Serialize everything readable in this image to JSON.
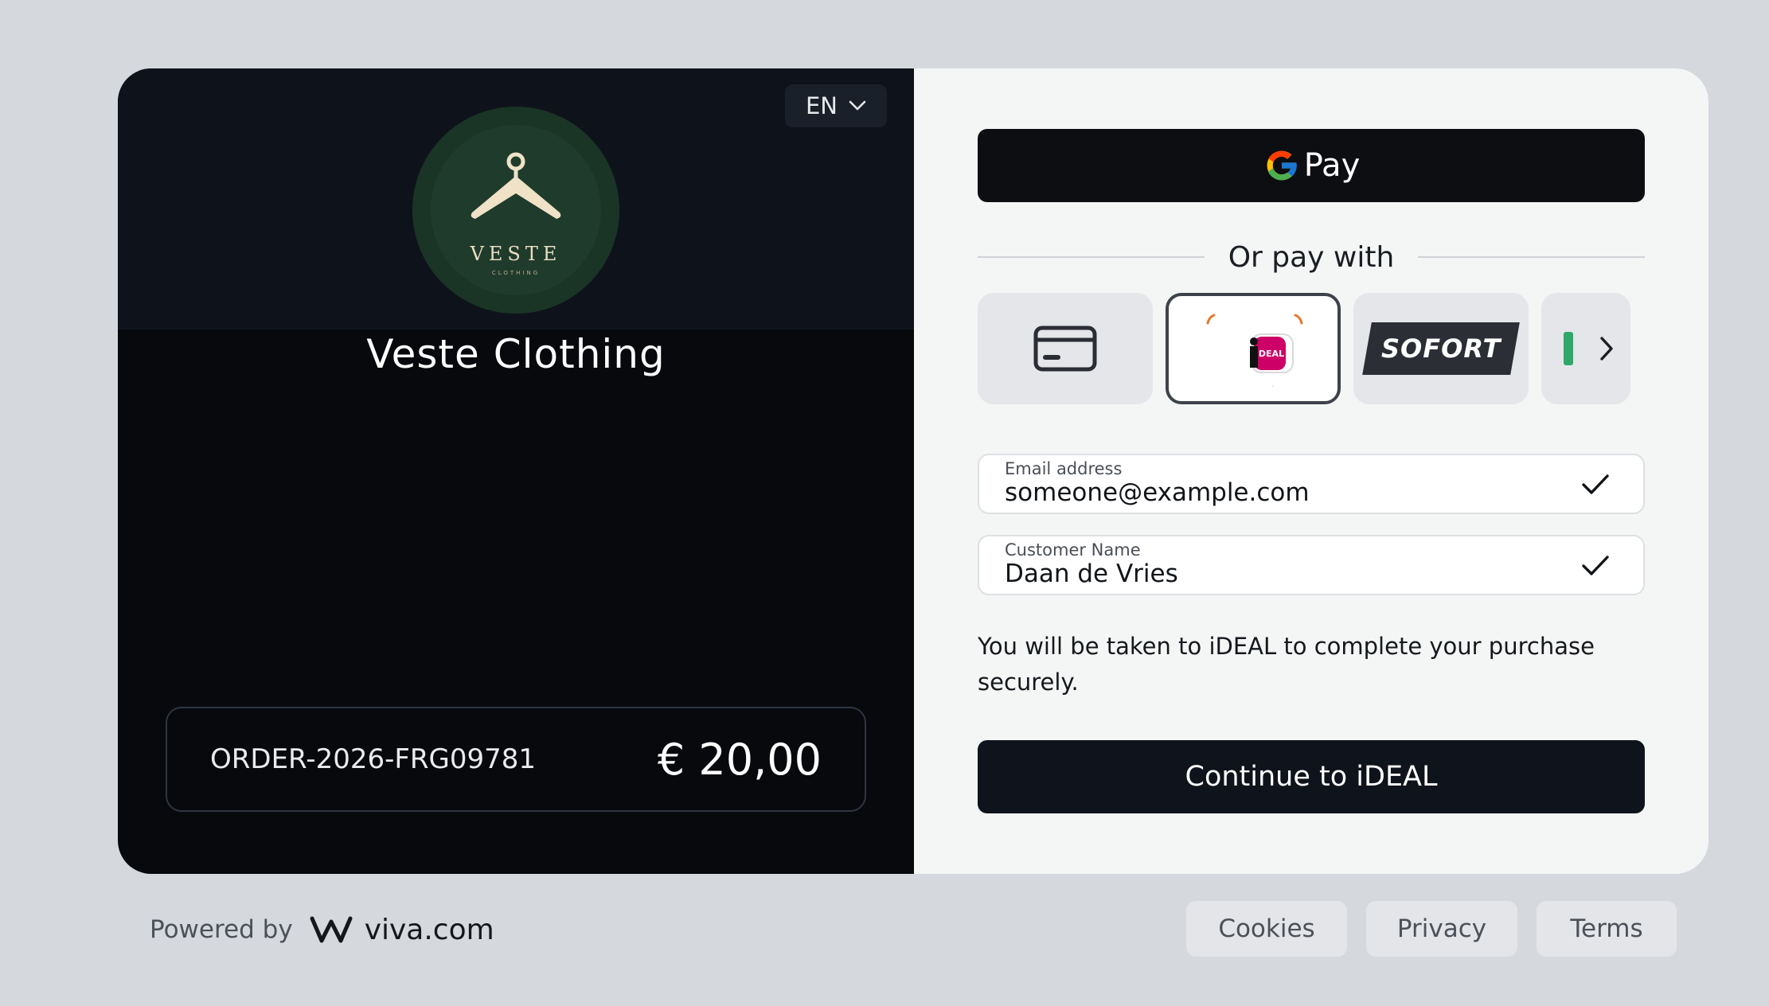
{
  "merchant": {
    "name": "Veste Clothing",
    "logo_word": "VESTE",
    "logo_sub": "CLOTHING"
  },
  "language": {
    "selected": "EN",
    "icon": "chevron-down-icon"
  },
  "order": {
    "id": "ORDER-2026-FRG09781",
    "amount": "€ 20,00"
  },
  "gpay": {
    "label": "Pay",
    "icon": "google-g-icon"
  },
  "divider_text": "Or pay with",
  "payment_methods": [
    {
      "name": "card",
      "icon": "credit-card-icon",
      "selected": false
    },
    {
      "name": "ideal",
      "icon": "ideal-logo-icon",
      "label": "iDEAL",
      "selected": true
    },
    {
      "name": "sofort",
      "label": "SOFORT",
      "selected": false
    },
    {
      "name": "more",
      "icon": "chevron-right-icon",
      "selected": false
    }
  ],
  "form": {
    "email": {
      "label": "Email address",
      "value": "someone@example.com",
      "valid": true
    },
    "customer_name": {
      "label": "Customer Name",
      "value": "Daan de Vries",
      "valid": true
    }
  },
  "info_text": "You will be taken to iDEAL to complete your purchase securely.",
  "continue_label": "Continue to iDEAL",
  "footer": {
    "powered_by": "Powered by",
    "brand": "viva.com",
    "links": [
      "Cookies",
      "Privacy",
      "Terms"
    ]
  },
  "colors": {
    "page_bg": "#d5d8dd",
    "left_panel": "#07090d",
    "right_panel": "#f4f6f5",
    "button_dark": "#0f131b",
    "ideal_pink": "#cc0066",
    "logo_green": "#1f3b2b"
  }
}
